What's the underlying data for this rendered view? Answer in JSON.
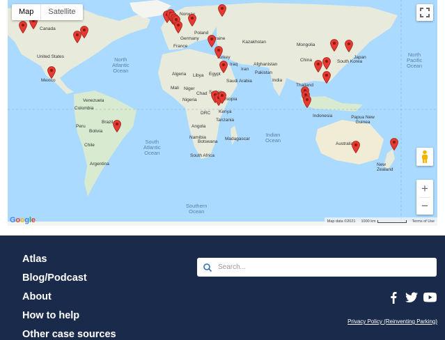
{
  "map": {
    "type_options": [
      "Map",
      "Satellite"
    ],
    "active_type": "Map",
    "oceans": {
      "north_atlantic": "North\nAtlantic\nOcean",
      "south_atlantic": "South\nAtlantic\nOcean",
      "indian": "Indian\nOcean",
      "north_pacific": "North\nPacific\nOcean",
      "southern": "Southern\nOcean"
    },
    "countries": [
      "Canada",
      "United States",
      "Mexico",
      "Venezuela",
      "Colombia",
      "Brazil",
      "Peru",
      "Bolivia",
      "Chile",
      "Argentina",
      "Norway",
      "Poland",
      "Germany",
      "France",
      "Ukraine",
      "Kazakhstan",
      "Mongolia",
      "China",
      "Turkey",
      "Iran",
      "Iraq",
      "Afghanistan",
      "Pakistan",
      "India",
      "Thailand",
      "Algeria",
      "Libya",
      "Egypt",
      "Mali",
      "Niger",
      "Chad",
      "Sudan",
      "Saudi Arabia",
      "Nigeria",
      "Ethiopia",
      "DRC",
      "Kenya",
      "Tanzania",
      "Angola",
      "Namibia",
      "Botswana",
      "South Africa",
      "Madagascar",
      "Indonesia",
      "Papua New Guinea",
      "Australia",
      "New Zealand",
      "Japan",
      "South Korea"
    ],
    "google_logo": "Google",
    "attribution": {
      "map_data": "Map data ©2021",
      "scale": "1000 km",
      "terms": "Terms of Use"
    },
    "pin_color": "#e53935",
    "pin_count": 41
  },
  "footer": {
    "bg_color": "#1a2a4a",
    "nav": [
      "Atlas",
      "Blog/Podcast",
      "About",
      "How to help",
      "Other case sources"
    ],
    "search_placeholder": "Search...",
    "social_icons": [
      "facebook-icon",
      "twitter-icon",
      "youtube-icon"
    ],
    "privacy_link": "Privacy Policy (Reinventing Parking)"
  }
}
